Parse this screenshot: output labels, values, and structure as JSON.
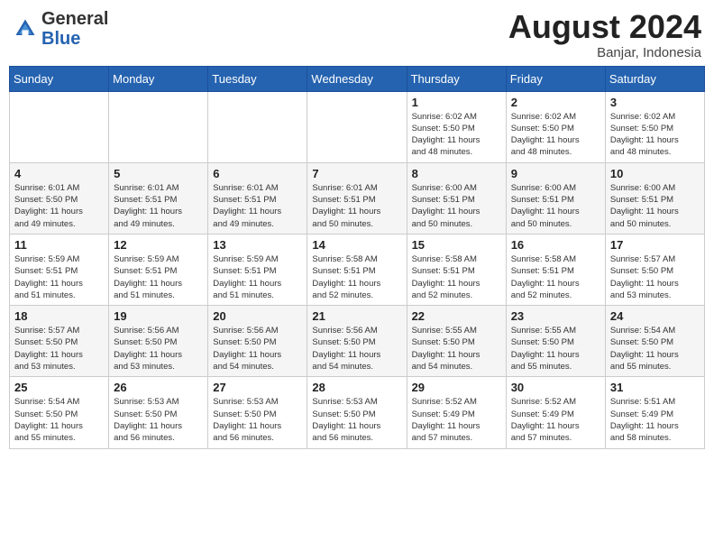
{
  "header": {
    "logo_general": "General",
    "logo_blue": "Blue",
    "month_year": "August 2024",
    "location": "Banjar, Indonesia"
  },
  "weekdays": [
    "Sunday",
    "Monday",
    "Tuesday",
    "Wednesday",
    "Thursday",
    "Friday",
    "Saturday"
  ],
  "weeks": [
    [
      {
        "day": "",
        "info": ""
      },
      {
        "day": "",
        "info": ""
      },
      {
        "day": "",
        "info": ""
      },
      {
        "day": "",
        "info": ""
      },
      {
        "day": "1",
        "info": "Sunrise: 6:02 AM\nSunset: 5:50 PM\nDaylight: 11 hours\nand 48 minutes."
      },
      {
        "day": "2",
        "info": "Sunrise: 6:02 AM\nSunset: 5:50 PM\nDaylight: 11 hours\nand 48 minutes."
      },
      {
        "day": "3",
        "info": "Sunrise: 6:02 AM\nSunset: 5:50 PM\nDaylight: 11 hours\nand 48 minutes."
      }
    ],
    [
      {
        "day": "4",
        "info": "Sunrise: 6:01 AM\nSunset: 5:50 PM\nDaylight: 11 hours\nand 49 minutes."
      },
      {
        "day": "5",
        "info": "Sunrise: 6:01 AM\nSunset: 5:51 PM\nDaylight: 11 hours\nand 49 minutes."
      },
      {
        "day": "6",
        "info": "Sunrise: 6:01 AM\nSunset: 5:51 PM\nDaylight: 11 hours\nand 49 minutes."
      },
      {
        "day": "7",
        "info": "Sunrise: 6:01 AM\nSunset: 5:51 PM\nDaylight: 11 hours\nand 50 minutes."
      },
      {
        "day": "8",
        "info": "Sunrise: 6:00 AM\nSunset: 5:51 PM\nDaylight: 11 hours\nand 50 minutes."
      },
      {
        "day": "9",
        "info": "Sunrise: 6:00 AM\nSunset: 5:51 PM\nDaylight: 11 hours\nand 50 minutes."
      },
      {
        "day": "10",
        "info": "Sunrise: 6:00 AM\nSunset: 5:51 PM\nDaylight: 11 hours\nand 50 minutes."
      }
    ],
    [
      {
        "day": "11",
        "info": "Sunrise: 5:59 AM\nSunset: 5:51 PM\nDaylight: 11 hours\nand 51 minutes."
      },
      {
        "day": "12",
        "info": "Sunrise: 5:59 AM\nSunset: 5:51 PM\nDaylight: 11 hours\nand 51 minutes."
      },
      {
        "day": "13",
        "info": "Sunrise: 5:59 AM\nSunset: 5:51 PM\nDaylight: 11 hours\nand 51 minutes."
      },
      {
        "day": "14",
        "info": "Sunrise: 5:58 AM\nSunset: 5:51 PM\nDaylight: 11 hours\nand 52 minutes."
      },
      {
        "day": "15",
        "info": "Sunrise: 5:58 AM\nSunset: 5:51 PM\nDaylight: 11 hours\nand 52 minutes."
      },
      {
        "day": "16",
        "info": "Sunrise: 5:58 AM\nSunset: 5:51 PM\nDaylight: 11 hours\nand 52 minutes."
      },
      {
        "day": "17",
        "info": "Sunrise: 5:57 AM\nSunset: 5:50 PM\nDaylight: 11 hours\nand 53 minutes."
      }
    ],
    [
      {
        "day": "18",
        "info": "Sunrise: 5:57 AM\nSunset: 5:50 PM\nDaylight: 11 hours\nand 53 minutes."
      },
      {
        "day": "19",
        "info": "Sunrise: 5:56 AM\nSunset: 5:50 PM\nDaylight: 11 hours\nand 53 minutes."
      },
      {
        "day": "20",
        "info": "Sunrise: 5:56 AM\nSunset: 5:50 PM\nDaylight: 11 hours\nand 54 minutes."
      },
      {
        "day": "21",
        "info": "Sunrise: 5:56 AM\nSunset: 5:50 PM\nDaylight: 11 hours\nand 54 minutes."
      },
      {
        "day": "22",
        "info": "Sunrise: 5:55 AM\nSunset: 5:50 PM\nDaylight: 11 hours\nand 54 minutes."
      },
      {
        "day": "23",
        "info": "Sunrise: 5:55 AM\nSunset: 5:50 PM\nDaylight: 11 hours\nand 55 minutes."
      },
      {
        "day": "24",
        "info": "Sunrise: 5:54 AM\nSunset: 5:50 PM\nDaylight: 11 hours\nand 55 minutes."
      }
    ],
    [
      {
        "day": "25",
        "info": "Sunrise: 5:54 AM\nSunset: 5:50 PM\nDaylight: 11 hours\nand 55 minutes."
      },
      {
        "day": "26",
        "info": "Sunrise: 5:53 AM\nSunset: 5:50 PM\nDaylight: 11 hours\nand 56 minutes."
      },
      {
        "day": "27",
        "info": "Sunrise: 5:53 AM\nSunset: 5:50 PM\nDaylight: 11 hours\nand 56 minutes."
      },
      {
        "day": "28",
        "info": "Sunrise: 5:53 AM\nSunset: 5:50 PM\nDaylight: 11 hours\nand 56 minutes."
      },
      {
        "day": "29",
        "info": "Sunrise: 5:52 AM\nSunset: 5:49 PM\nDaylight: 11 hours\nand 57 minutes."
      },
      {
        "day": "30",
        "info": "Sunrise: 5:52 AM\nSunset: 5:49 PM\nDaylight: 11 hours\nand 57 minutes."
      },
      {
        "day": "31",
        "info": "Sunrise: 5:51 AM\nSunset: 5:49 PM\nDaylight: 11 hours\nand 58 minutes."
      }
    ]
  ]
}
